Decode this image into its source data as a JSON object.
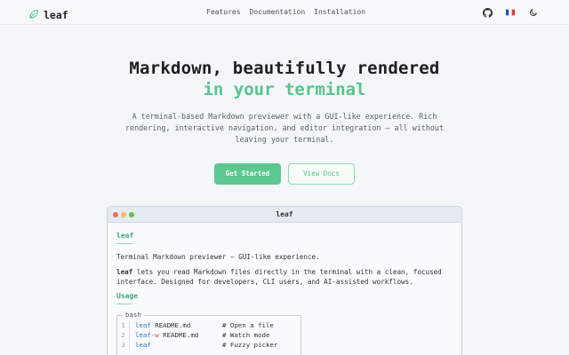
{
  "header": {
    "logo_text": "leaf",
    "nav": [
      "Features",
      "Documentation",
      "Installation"
    ],
    "icons": [
      "github-icon",
      "france-flag-icon",
      "moon-icon"
    ]
  },
  "hero": {
    "title": "Markdown, beautifully rendered",
    "accent": "in your terminal",
    "description": "A terminal-based Markdown previewer with a GUI-like experience. Rich rendering, interactive navigation, and editor integration — all without leaving your terminal.",
    "primary_button": "Get Started",
    "secondary_button": "View Docs"
  },
  "terminal": {
    "title": "leaf",
    "heading": "leaf",
    "tagline": "Terminal Markdown previewer — GUI-like experience.",
    "intro_bold": "leaf",
    "intro_rest": " lets you read Markdown files directly in the terminal with a clean, focused interface. Designed for developers, CLI users, and AI-assisted workflows.",
    "usage_heading": "Usage",
    "code_lang": "bash",
    "code_lines": [
      {
        "num": "1",
        "cmd": "leaf",
        "flag": "",
        "arg": " README.md",
        "comment": "# Open a file"
      },
      {
        "num": "2",
        "cmd": "leaf",
        "flag": " -w",
        "arg": " README.md",
        "comment": "# Watch mode"
      },
      {
        "num": "3",
        "cmd": "leaf",
        "flag": "",
        "arg": "",
        "comment": "# Fuzzy picker"
      }
    ]
  },
  "colors": {
    "accent": "#57c48a",
    "background": "#f4f7fa"
  }
}
